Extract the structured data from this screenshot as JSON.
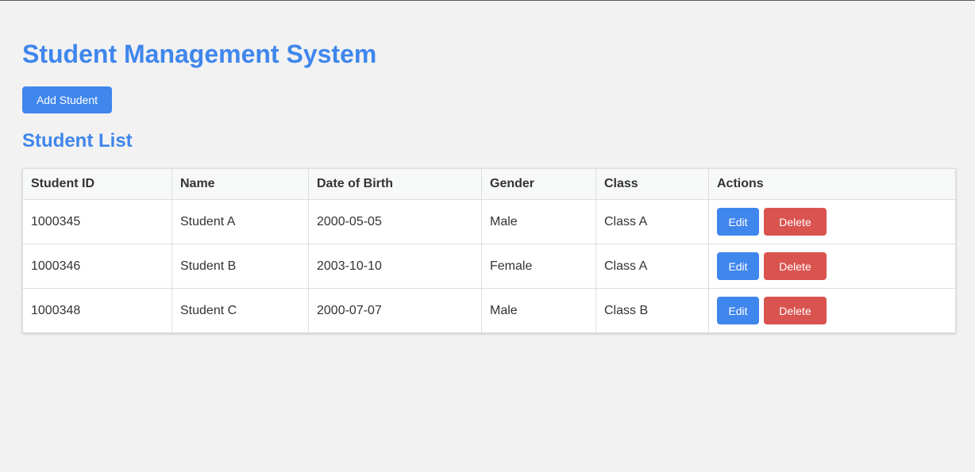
{
  "header": {
    "title": "Student Management System",
    "add_button_label": "Add Student"
  },
  "list": {
    "title": "Student List",
    "columns": [
      "Student ID",
      "Name",
      "Date of Birth",
      "Gender",
      "Class",
      "Actions"
    ],
    "rows": [
      {
        "id": "1000345",
        "name": "Student A",
        "dob": "2000-05-05",
        "gender": "Male",
        "class": "Class A"
      },
      {
        "id": "1000346",
        "name": "Student B",
        "dob": "2003-10-10",
        "gender": "Female",
        "class": "Class A"
      },
      {
        "id": "1000348",
        "name": "Student C",
        "dob": "2000-07-07",
        "gender": "Male",
        "class": "Class B"
      }
    ],
    "edit_label": "Edit",
    "delete_label": "Delete"
  },
  "colors": {
    "accent": "#3f86ed",
    "danger": "#d9534f",
    "background": "#f2f2f2"
  }
}
